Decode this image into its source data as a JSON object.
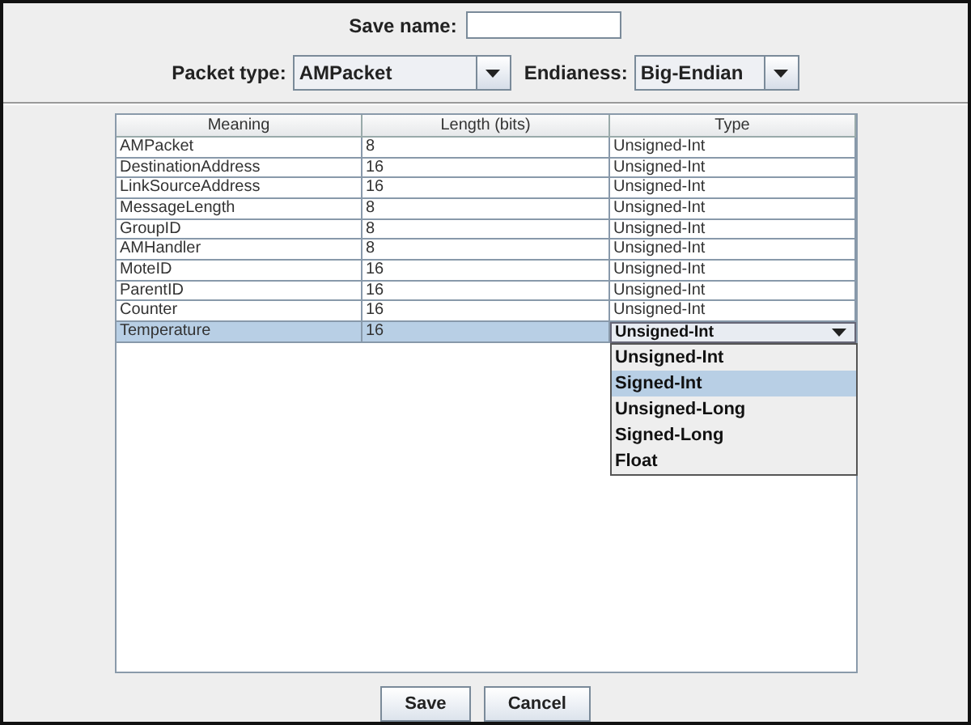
{
  "save_name": {
    "label": "Save name:"
  },
  "packet_type": {
    "label": "Packet type:",
    "value": "AMPacket"
  },
  "endianess": {
    "label": "Endianess:",
    "value": "Big-Endian"
  },
  "table": {
    "columns": [
      "Meaning",
      "Length (bits)",
      "Type"
    ],
    "rows": [
      {
        "meaning": "AMPacket",
        "length": "8",
        "type": "Unsigned-Int",
        "selected": false
      },
      {
        "meaning": "DestinationAddress",
        "length": "16",
        "type": "Unsigned-Int",
        "selected": false
      },
      {
        "meaning": "LinkSourceAddress",
        "length": "16",
        "type": "Unsigned-Int",
        "selected": false
      },
      {
        "meaning": "MessageLength",
        "length": "8",
        "type": "Unsigned-Int",
        "selected": false
      },
      {
        "meaning": "GroupID",
        "length": "8",
        "type": "Unsigned-Int",
        "selected": false
      },
      {
        "meaning": "AMHandler",
        "length": "8",
        "type": "Unsigned-Int",
        "selected": false
      },
      {
        "meaning": "MoteID",
        "length": "16",
        "type": "Unsigned-Int",
        "selected": false
      },
      {
        "meaning": "ParentID",
        "length": "16",
        "type": "Unsigned-Int",
        "selected": false
      },
      {
        "meaning": "Counter",
        "length": "16",
        "type": "Unsigned-Int",
        "selected": false
      },
      {
        "meaning": "Temperature",
        "length": "16",
        "type": "Unsigned-Int",
        "selected": true
      }
    ]
  },
  "type_dropdown": {
    "options": [
      {
        "label": "Unsigned-Int",
        "selected": false
      },
      {
        "label": "Signed-Int",
        "selected": true
      },
      {
        "label": "Unsigned-Long",
        "selected": false
      },
      {
        "label": "Signed-Long",
        "selected": false
      },
      {
        "label": "Float",
        "selected": false
      }
    ]
  },
  "buttons": [
    "Save",
    "Cancel"
  ]
}
